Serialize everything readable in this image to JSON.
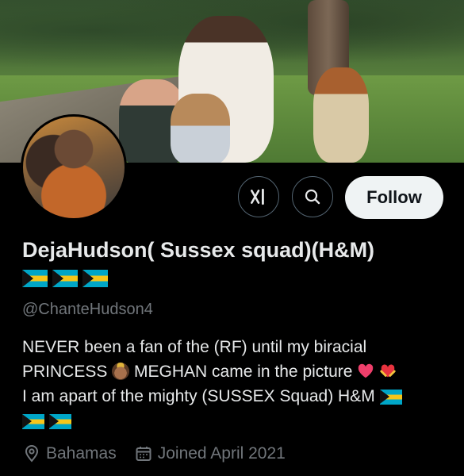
{
  "profile": {
    "display_name": "DejaHudson( Sussex squad)(H&M)",
    "handle": "@ChanteHudson4",
    "bio_line1": "NEVER been a fan of the (RF) until my biracial",
    "bio_line2a": "PRINCESS",
    "bio_line2b": "MEGHAN came in the picture",
    "bio_line3": "I am apart of the mighty (SUSSEX Squad) H&M",
    "location": "Bahamas",
    "joined": "Joined April 2021"
  },
  "actions": {
    "follow_label": "Follow"
  },
  "icons": {
    "grok": "grok-icon",
    "search": "search-icon",
    "location": "location-icon",
    "calendar": "calendar-icon",
    "flag": "bahamas-flag-emoji",
    "princess": "princess-emoji",
    "heart": "sparkling-heart-emoji",
    "heart_hands": "heart-hands-emoji"
  },
  "colors": {
    "background": "#000000",
    "text": "#e7e9ea",
    "muted": "#71767b",
    "follow_bg": "#eff3f4"
  }
}
